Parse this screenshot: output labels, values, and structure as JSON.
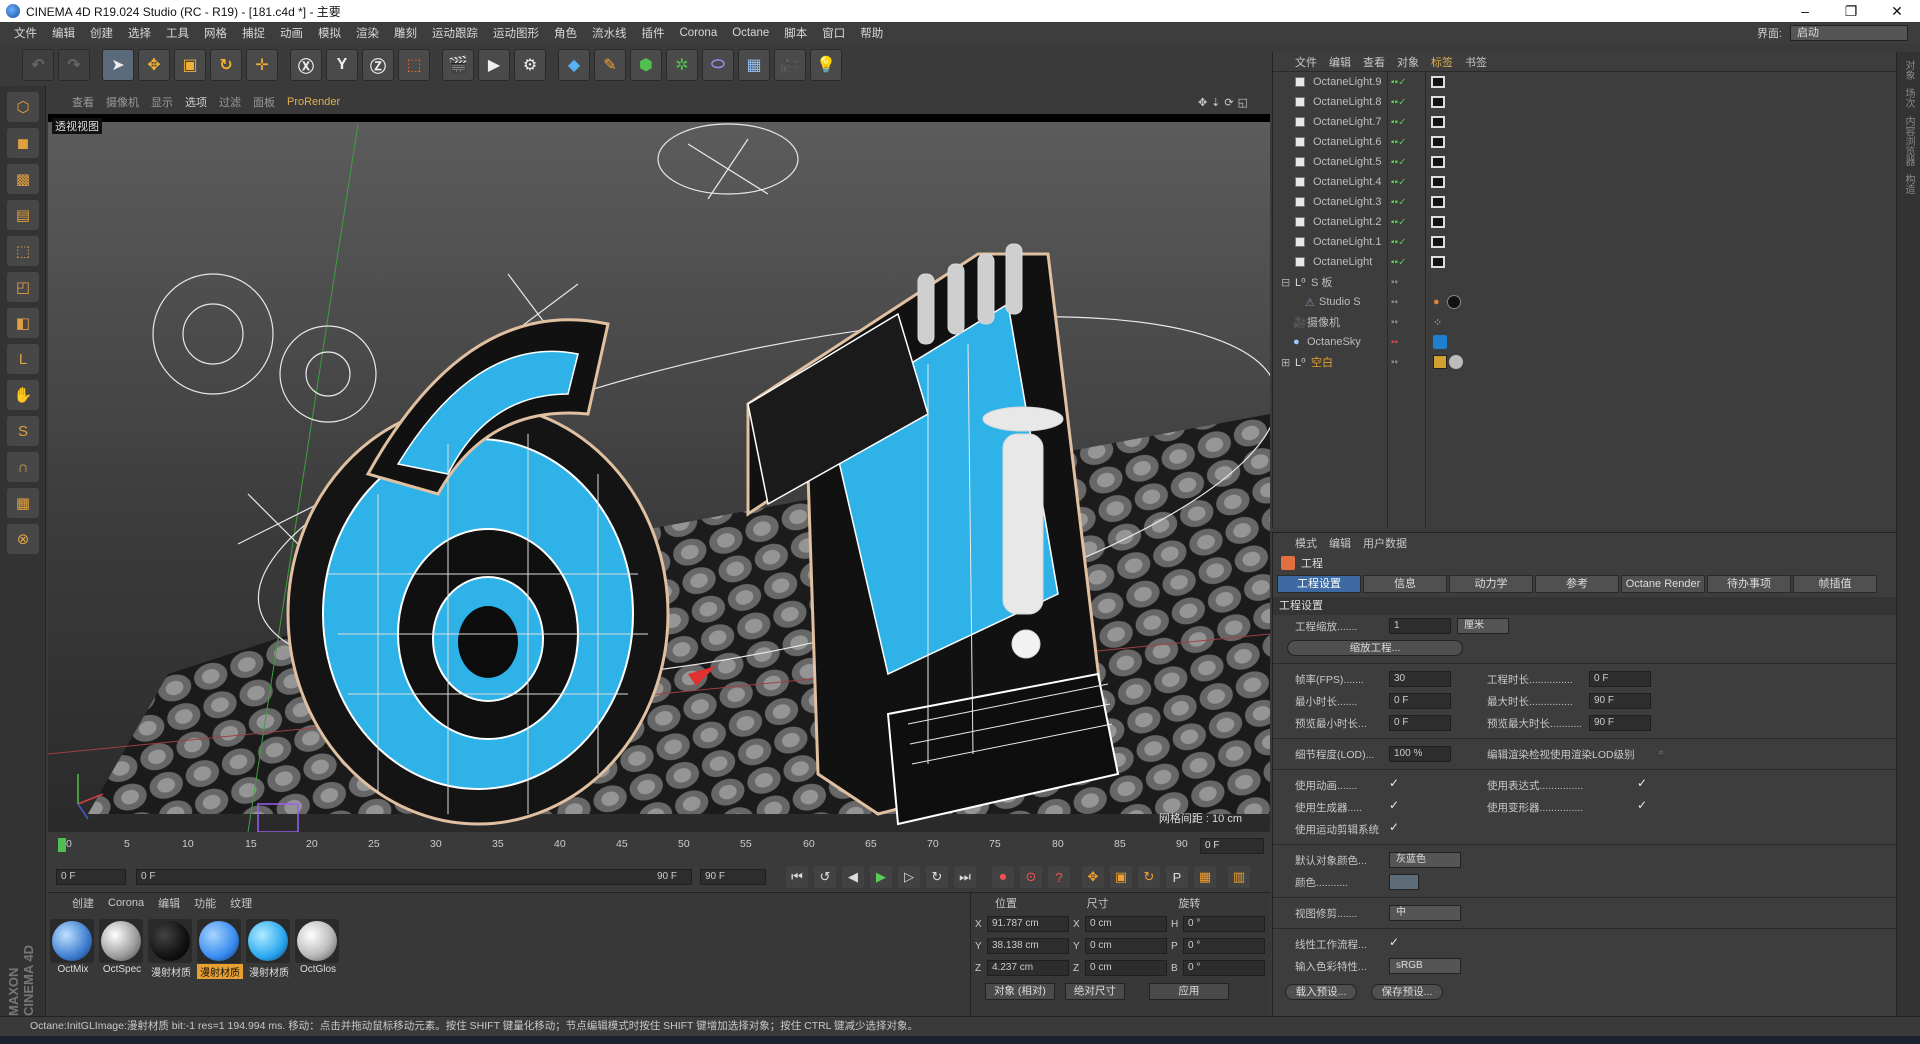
{
  "window": {
    "title": "CINEMA 4D R19.024 Studio (RC - R19) - [181.c4d *] - 主要"
  },
  "menu": {
    "items": [
      "文件",
      "编辑",
      "创建",
      "选择",
      "工具",
      "网格",
      "捕捉",
      "动画",
      "模拟",
      "渲染",
      "雕刻",
      "运动跟踪",
      "运动图形",
      "角色",
      "流水线",
      "插件",
      "Corona",
      "Octane",
      "脚本",
      "窗口",
      "帮助"
    ],
    "layout_label": "界面:",
    "layout_value": "启动"
  },
  "viewport": {
    "menu": [
      "查看",
      "摄像机",
      "显示",
      "选项",
      "过滤",
      "面板",
      "ProRender"
    ],
    "label": "透视视图",
    "grid_spacing": "网格间距 : 10 cm"
  },
  "timeline": {
    "ticks": [
      "0",
      "5",
      "10",
      "15",
      "20",
      "25",
      "30",
      "35",
      "40",
      "45",
      "50",
      "55",
      "60",
      "65",
      "70",
      "75",
      "80",
      "85",
      "90"
    ],
    "current_frame": "0 F",
    "start": "0 F",
    "range_start": "0 F",
    "range_end": "90 F",
    "end": "90 F"
  },
  "materials": {
    "menu": [
      "创建",
      "Corona",
      "编辑",
      "功能",
      "纹理"
    ],
    "items": [
      {
        "name": "OctMix",
        "color": "#3f7fd0"
      },
      {
        "name": "OctSpec",
        "color": "#9a9a9a"
      },
      {
        "name": "漫射材质",
        "color": "#111111"
      },
      {
        "name": "漫射材质",
        "color": "#3a8cf0",
        "selected": true
      },
      {
        "name": "漫射材质",
        "color": "#2aa8f0"
      },
      {
        "name": "OctGlos",
        "color": "#bcbcbc"
      }
    ]
  },
  "coords": {
    "headers": [
      "位置",
      "尺寸",
      "旋转"
    ],
    "rows": [
      {
        "axis": "X",
        "pos": "91.787 cm",
        "size_axis": "X",
        "size": "0 cm",
        "rot_axis": "H",
        "rot": "0 °"
      },
      {
        "axis": "Y",
        "pos": "38.138 cm",
        "size_axis": "Y",
        "size": "0 cm",
        "rot_axis": "P",
        "rot": "0 °"
      },
      {
        "axis": "Z",
        "pos": "4.237 cm",
        "size_axis": "Z",
        "size": "0 cm",
        "rot_axis": "B",
        "rot": "0 °"
      }
    ],
    "mode": "对象 (相对)",
    "size_mode": "绝对尺寸",
    "apply": "应用"
  },
  "objects": {
    "menu": [
      "文件",
      "编辑",
      "查看",
      "对象",
      "标签",
      "书签"
    ],
    "items": [
      {
        "name": "OctaneLight.9",
        "type": "light"
      },
      {
        "name": "OctaneLight.8",
        "type": "light"
      },
      {
        "name": "OctaneLight.7",
        "type": "light"
      },
      {
        "name": "OctaneLight.6",
        "type": "light"
      },
      {
        "name": "OctaneLight.5",
        "type": "light"
      },
      {
        "name": "OctaneLight.4",
        "type": "light"
      },
      {
        "name": "OctaneLight.3",
        "type": "light"
      },
      {
        "name": "OctaneLight.2",
        "type": "light"
      },
      {
        "name": "OctaneLight.1",
        "type": "light"
      },
      {
        "name": "OctaneLight",
        "type": "light"
      },
      {
        "name": "S 板",
        "type": "null"
      },
      {
        "name": "Studio S",
        "type": "child"
      },
      {
        "name": "摄像机",
        "type": "camera"
      },
      {
        "name": "OctaneSky",
        "type": "sky"
      },
      {
        "name": "空白",
        "type": "null-orange"
      }
    ]
  },
  "attributes": {
    "menu": [
      "模式",
      "编辑",
      "用户数据"
    ],
    "title": "工程",
    "tabs": [
      "工程设置",
      "信息",
      "动力学",
      "参考",
      "Octane Render",
      "待办事项",
      "帧插值"
    ],
    "section": "工程设置",
    "scale_label": "工程缩放.......",
    "scale_value": "1",
    "scale_unit": "厘米",
    "scale_button": "缩放工程...",
    "fps_label": "帧率(FPS).......",
    "fps_value": "30",
    "duration_label": "工程时长...............",
    "duration_value": "0 F",
    "min_time_label": "最小时长.......",
    "min_time_value": "0 F",
    "max_time_label": "最大时长...............",
    "max_time_value": "90 F",
    "preview_min_label": "预览最小时长...",
    "preview_min_value": "0 F",
    "preview_max_label": "预览最大时长...........",
    "preview_max_value": "90 F",
    "lod_label": "细节程度(LOD)...",
    "lod_value": "100 %",
    "lod_render_label": "编辑渲染检视使用渲染LOD级别",
    "use_anim_label": "使用动画.......",
    "use_expr_label": "使用表达式...............",
    "use_gen_label": "使用生成器.....",
    "use_deform_label": "使用变形器...............",
    "use_motion_label": "使用运动剪辑系统",
    "default_color_label": "默认对象颜色...",
    "default_color_value": "灰蓝色",
    "color_label": "颜色...........",
    "view_clip_label": "视图修剪.......",
    "view_clip_value": "中",
    "linear_label": "线性工作流程...",
    "input_color_label": "输入色彩特性...",
    "input_color_value": "sRGB",
    "load_preset": "载入预设...",
    "save_preset": "保存预设..."
  },
  "status": {
    "text": "Octane:InitGLImage:漫射材质 bit:-1 res=1 194.994 ms.     移动：点击并拖动鼠标移动元素。按住 SHIFT 键量化移动；节点编辑模式时按住 SHIFT 键增加选择对象；按住 CTRL 键减少选择对象。"
  },
  "brand": {
    "maxon": "MAXON CINEMA 4D"
  },
  "colors": {
    "accent": "#3d6aa3",
    "highlight": "#e8a030",
    "check": "#58c858"
  }
}
